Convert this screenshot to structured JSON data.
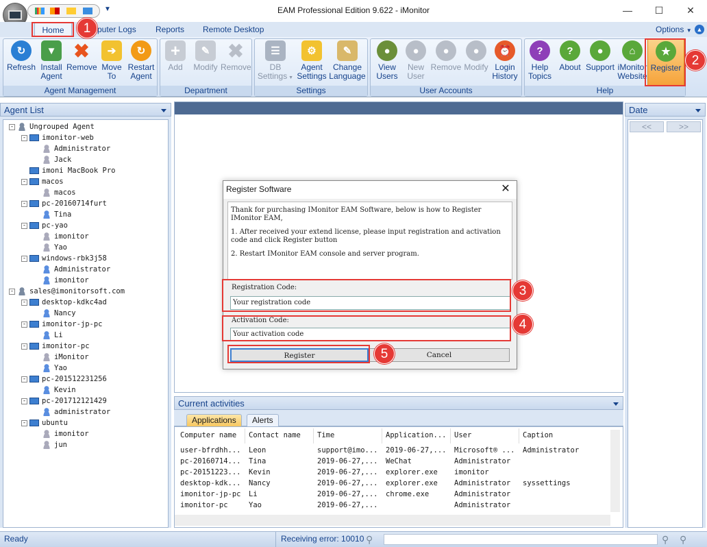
{
  "window": {
    "title": "EAM Professional Edition 9.622 - iMonitor"
  },
  "tabs": {
    "home": "Home",
    "computer_logs": "Computer Logs",
    "computer_logs_visible": "puter Logs",
    "reports": "Reports",
    "remote_desktop": "Remote Desktop",
    "options": "Options"
  },
  "ribbon": {
    "agent_management": {
      "label": "Agent Management",
      "refresh": [
        "Refresh",
        ""
      ],
      "install": [
        "Install",
        "Agent"
      ],
      "remove": [
        "Remove",
        ""
      ],
      "move": [
        "Move",
        "To"
      ],
      "restart": [
        "Restart",
        "Agent"
      ]
    },
    "department": {
      "label": "Department",
      "add": "Add",
      "modify": "Modify",
      "remove": "Remove"
    },
    "settings": {
      "label": "Settings",
      "db": [
        "DB",
        "Settings"
      ],
      "agent": [
        "Agent",
        "Settings"
      ],
      "language": [
        "Change",
        "Language"
      ]
    },
    "user_accounts": {
      "label": "User Accounts",
      "view": [
        "View",
        "Users"
      ],
      "new": [
        "New",
        "User"
      ],
      "remove": "Remove",
      "modify": "Modify",
      "login": [
        "Login",
        "History"
      ]
    },
    "help": {
      "label": "Help",
      "topics": [
        "Help",
        "Topics"
      ],
      "about": "About",
      "support": "Support",
      "website": [
        "iMonitor",
        "Website"
      ],
      "register": "Register"
    }
  },
  "agent_list": {
    "title": "Agent List",
    "nodes": [
      {
        "text": "Ungrouped Agent",
        "level": 0,
        "kind": "grp",
        "toggle": "-"
      },
      {
        "text": "imonitor-web",
        "level": 1,
        "kind": "pc",
        "toggle": "-"
      },
      {
        "text": "Administrator",
        "level": 2,
        "kind": "usergray"
      },
      {
        "text": "Jack",
        "level": 2,
        "kind": "usergray"
      },
      {
        "text": "imoni      MacBook Pro",
        "level": 1,
        "kind": "pc"
      },
      {
        "text": "macos",
        "level": 1,
        "kind": "pc",
        "toggle": "-"
      },
      {
        "text": "macos",
        "level": 2,
        "kind": "usergray"
      },
      {
        "text": "pc-20160714furt",
        "level": 1,
        "kind": "pc",
        "toggle": "-"
      },
      {
        "text": "Tina",
        "level": 2,
        "kind": "user"
      },
      {
        "text": "pc-yao",
        "level": 1,
        "kind": "pc",
        "toggle": "-"
      },
      {
        "text": "imonitor",
        "level": 2,
        "kind": "usergray"
      },
      {
        "text": "Yao",
        "level": 2,
        "kind": "usergray"
      },
      {
        "text": "windows-rbk3j58",
        "level": 1,
        "kind": "pc",
        "toggle": "-"
      },
      {
        "text": "Administrator",
        "level": 2,
        "kind": "user"
      },
      {
        "text": "imonitor",
        "level": 2,
        "kind": "user"
      },
      {
        "text": "sales@imonitorsoft.com",
        "level": 0,
        "kind": "grp",
        "toggle": "-"
      },
      {
        "text": "desktop-kdkc4ad",
        "level": 1,
        "kind": "pc",
        "toggle": "-"
      },
      {
        "text": "Nancy",
        "level": 2,
        "kind": "user"
      },
      {
        "text": "imonitor-jp-pc",
        "level": 1,
        "kind": "pc",
        "toggle": "-"
      },
      {
        "text": "Li",
        "level": 2,
        "kind": "user"
      },
      {
        "text": "imonitor-pc",
        "level": 1,
        "kind": "pc",
        "toggle": "-"
      },
      {
        "text": "iMonitor",
        "level": 2,
        "kind": "usergray"
      },
      {
        "text": "Yao",
        "level": 2,
        "kind": "user"
      },
      {
        "text": "pc-201512231256",
        "level": 1,
        "kind": "pc",
        "toggle": "-"
      },
      {
        "text": "Kevin",
        "level": 2,
        "kind": "user"
      },
      {
        "text": "pc-201712121429",
        "level": 1,
        "kind": "pc",
        "toggle": "-"
      },
      {
        "text": "administrator",
        "level": 2,
        "kind": "user"
      },
      {
        "text": "ubuntu",
        "level": 1,
        "kind": "pc",
        "toggle": "-"
      },
      {
        "text": "imonitor",
        "level": 2,
        "kind": "usergray"
      },
      {
        "text": "jun",
        "level": 2,
        "kind": "usergray"
      }
    ]
  },
  "date_panel": {
    "title": "Date",
    "prev": "<<",
    "next": ">>"
  },
  "activities": {
    "title": "Current activities",
    "tabs": [
      "Applications",
      "Alerts"
    ],
    "columns": [
      "Computer name",
      "Contact name",
      "Time",
      "Application...",
      "User",
      "Caption"
    ],
    "rows": [
      [
        "user-bfrdhh...",
        "Leon",
        "support@imo...",
        "2019-06-27,...",
        "Microsoft® ...",
        "Administrator"
      ],
      [
        "pc-20160714...",
        "Tina",
        "2019-06-27,...",
        "WeChat",
        "Administrator",
        ""
      ],
      [
        "pc-20151223...",
        "Kevin",
        "2019-06-27,...",
        "explorer.exe",
        "imonitor",
        ""
      ],
      [
        "desktop-kdk...",
        "Nancy",
        "2019-06-27,...",
        "explorer.exe",
        "Administrator",
        "syssettings"
      ],
      [
        "imonitor-jp-pc",
        "Li",
        "2019-06-27,...",
        "chrome.exe",
        "Administrator",
        ""
      ],
      [
        "imonitor-pc",
        "Yao",
        "2019-06-27,...",
        "",
        "Administrator",
        ""
      ]
    ]
  },
  "dialog": {
    "title": "Register Software",
    "close": "✕",
    "message": [
      "Thank for purchasing IMonitor EAM Software, below is how to Register IMonitor EAM,",
      "1. After received your extend license, please input registration and activation code and click Register button",
      "2. Restart IMonitor EAM console and server program."
    ],
    "registration_label": "Registration Code:",
    "registration_value": "Your registration code",
    "activation_label": "Activation Code:",
    "activation_value": "Your activation code",
    "register_btn": "Register",
    "cancel_btn": "Cancel"
  },
  "callouts": [
    "1",
    "2",
    "3",
    "4",
    "5"
  ],
  "status": {
    "ready": "Ready",
    "error": "Receiving error: 10010"
  },
  "colors": {
    "accent": "#15428b",
    "callout": "#e53935",
    "register_highlight": "#f6a33a"
  }
}
